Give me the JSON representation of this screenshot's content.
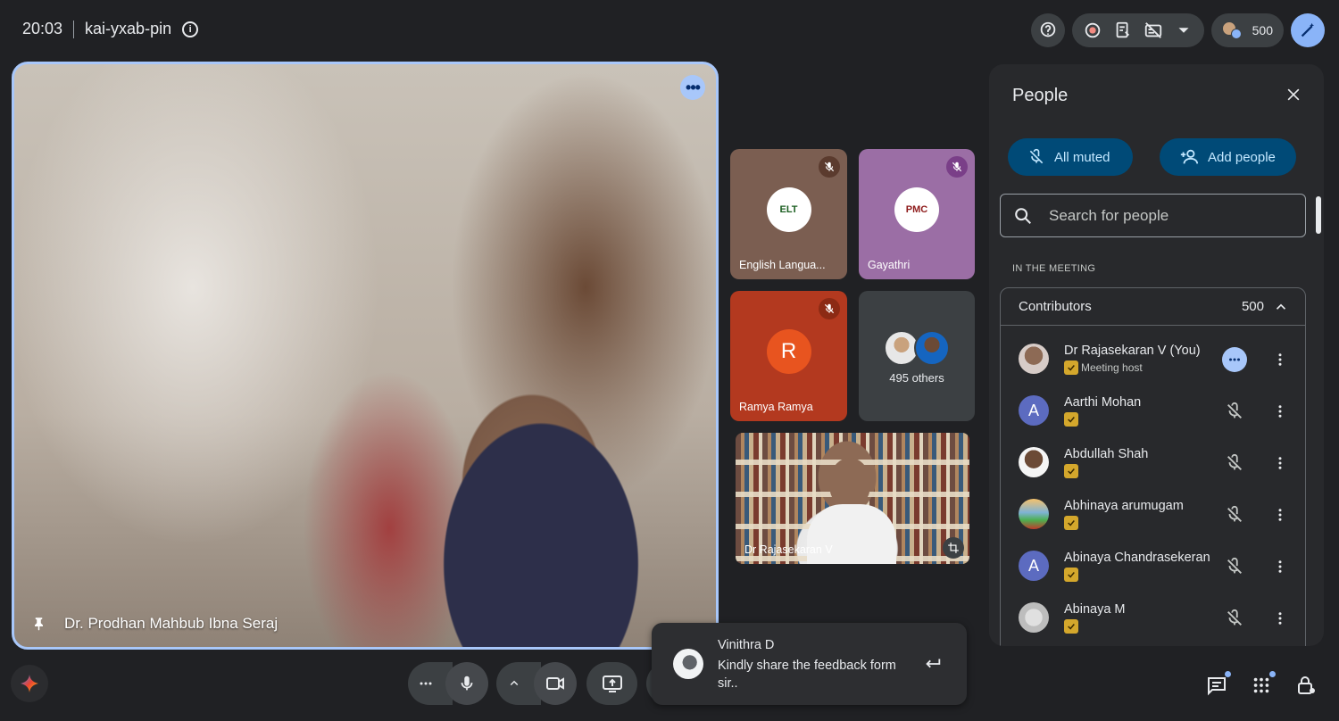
{
  "meeting": {
    "time": "20:03",
    "code": "kai-yxab-pin"
  },
  "header": {
    "participant_count": "500"
  },
  "main_video": {
    "speaker_name": "Dr. Prodhan Mahbub Ibna Seraj"
  },
  "tiles": [
    {
      "name": "English Langua...",
      "logo_text": "ELT"
    },
    {
      "name": "Gayathri",
      "logo_text": "PMC"
    },
    {
      "name": "Ramya Ramya",
      "initial": "R"
    },
    {
      "others_label": "495 others"
    },
    {
      "name": "Dr Rajasekaran V"
    }
  ],
  "people_panel": {
    "title": "People",
    "all_muted_label": "All muted",
    "add_people_label": "Add people",
    "search_placeholder": "Search for people",
    "section_label": "IN THE MEETING",
    "group_label": "Contributors",
    "group_count": "500",
    "people": [
      {
        "name": "Dr Rajasekaran V (You)",
        "subtitle": "Meeting host"
      },
      {
        "name": "Aarthi Mohan",
        "initial": "A"
      },
      {
        "name": "Abdullah Shah"
      },
      {
        "name": "Abhinaya arumugam"
      },
      {
        "name": "Abinaya Chandrasekeran",
        "initial": "A"
      },
      {
        "name": "Abinaya M"
      }
    ]
  },
  "chat_toast": {
    "sender": "Vinithra D",
    "message": "Kindly share the feedback form sir.."
  },
  "colors": {
    "accent": "#a8c7fa",
    "panel_button_bg": "#004a77",
    "background": "#202124"
  }
}
